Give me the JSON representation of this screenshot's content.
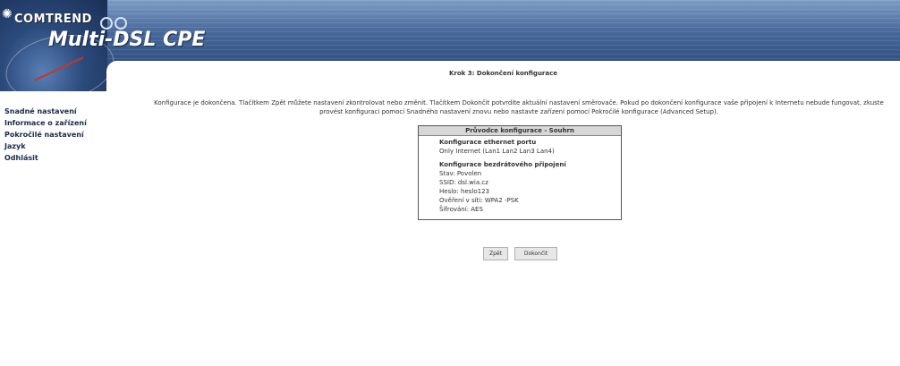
{
  "header": {
    "brand": "COMTREND",
    "product": "Multi-DSL CPE",
    "accent_color": "#2f4f81"
  },
  "sidebar": {
    "items": [
      {
        "label": "Snadné nastavení"
      },
      {
        "label": "Informace o zařízení"
      },
      {
        "label": "Pokročilé nastavení"
      },
      {
        "label": "Jazyk"
      },
      {
        "label": "Odhlásit"
      }
    ]
  },
  "main": {
    "title": "Krok 3: Dokončení konfigurace",
    "description": "Konfigurace je dokončena. Tlačítkem Zpět můžete nastavení zkontrolovat nebo změnit. Tlačítkem Dokončit potvrdíte aktuální nastavení směrovače. Pokud po dokončení konfigurace vaše připojení k Internetu nebude fungovat, zkuste provést konfiguraci pomocí Snadného nastavení znovu nebo nastavte zařízení pomocí Pokročilé konfigurace (Advanced Setup).",
    "summary": {
      "header": "Průvodce konfigurace - Souhrn",
      "ethernet_title": "Konfigurace ethernet portu",
      "ethernet_value": "Only Internet (Lan1 Lan2 Lan3 Lan4)",
      "wireless_title": "Konfigurace bezdrátového připojení",
      "wireless_lines": [
        "Stav: Povolen",
        "SSID: dsl.wia.cz",
        "Heslo: heslo123",
        "Ověření v síti: WPA2 -PSK",
        "Šifrování: AES"
      ]
    },
    "buttons": {
      "back": "Zpět",
      "finish": "Dokončit"
    }
  }
}
